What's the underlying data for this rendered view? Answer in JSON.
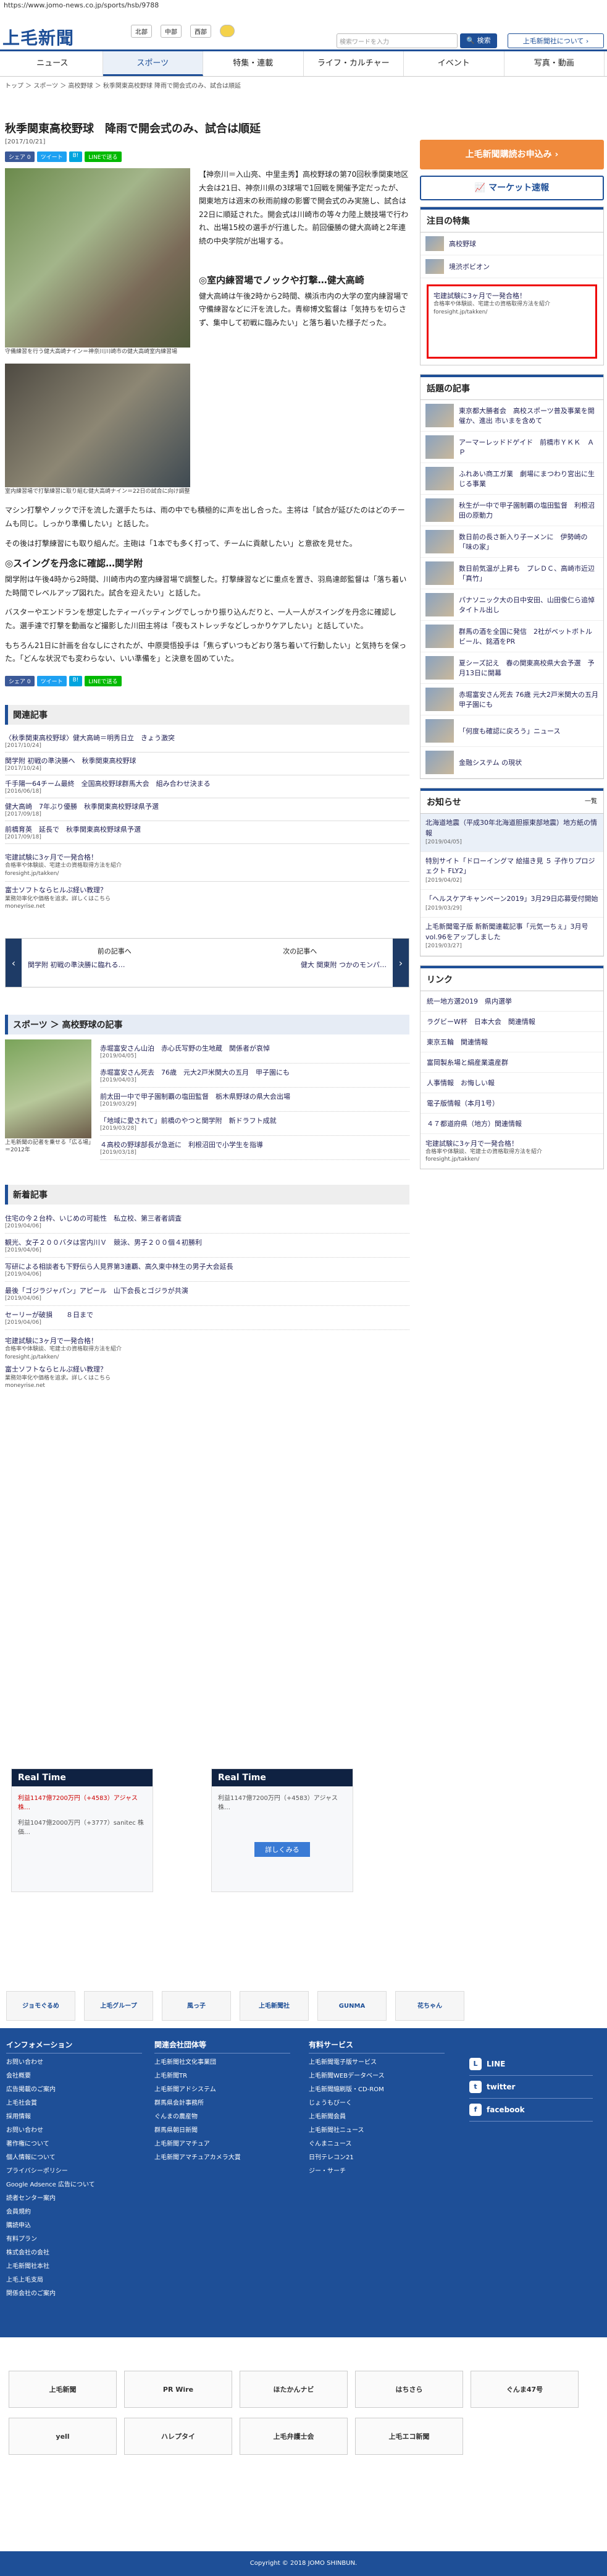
{
  "browser": {
    "url": "https://www.jomo-news.co.jp/sports/hsb/9788"
  },
  "header": {
    "logo": "上毛新聞",
    "regions": [
      "北部",
      "中部",
      "西部"
    ],
    "search_placeholder": "検索ワードを入力",
    "search_btn": "検索",
    "about_btn": "上毛新聞社について"
  },
  "nav": [
    "ニュース",
    "スポーツ",
    "特集・連載",
    "ライフ・カルチャー",
    "イベント",
    "写真・動画"
  ],
  "crumb": "トップ ＞ スポーツ ＞ 高校野球 ＞ 秋季関東高校野球 降雨で開会式のみ、試合は順延",
  "article": {
    "title": "秋季関東高校野球　降雨で開会式のみ、試合は順延",
    "date": "[2017/10/21]",
    "share": [
      "シェア 0",
      "ツイート",
      "B!",
      "LINEで送る"
    ],
    "caption1": "守備練習を行う健大高崎ナイン＝神奈川川崎市の健大高崎室内練習場",
    "p1": "【神奈川＝入山亮、中里圭秀】高校野球の第70回秋季関東地区大会は21日、神奈川県の3球場で1回戦を開催予定だったが、関東地方は週末の秋雨前線の影響で開会式のみ実施し、試合は22日に順延された。開会式は川崎市の等々力陸上競技場で行われ、出場15校の選手が行進した。前回優勝の健大高崎と2年連続の中央学院が出場する。",
    "h_sub1": "◎室内練習場でノックや打撃…健大高崎",
    "caption2": "室内練習場で打撃練習に取り組む健大高崎ナイン＝22日の試合に向け調整",
    "p2": "健大高崎は午後2時から2時間、横浜市内の大学の室内練習場で守備練習などに汗を流した。青柳博文監督は「気持ちを切らさず、集中して初戦に臨みたい」と落ち着いた様子だった。",
    "p3": "マシン打撃やノックで汗を流した選手たちは、雨の中でも積極的に声を出し合った。主将は「試合が延びたのはどのチームも同じ。しっかり準備したい」と話した。",
    "p4": "その後は打撃練習にも取り組んだ。主砲は「1本でも多く打って、チームに貢献したい」と意欲を見せた。",
    "h_sub2": "◎スイングを丹念に確認…関学附",
    "p5": "関学附は午後4時から2時間、川崎市内の室内練習場で調整した。打撃練習などに重点を置き、羽鳥達郎監督は「落ち着いた時間でレベルアップ図れた。試合を迎えたい」と話した。",
    "p6": "バスターやエンドランを想定したティーバッティングでしっかり振り込んだりと、一人一人がスイングを丹念に確認した。選手達で打撃を動画など撮影した川田主将は「夜もストレッチなどしっかりケアしたい」と話していた。",
    "p7": "もちろん21日に計画を台なしにされたが、中原奨悟投手は「焦らずいつもどおり落ち着いて行動したい」と気持ちを保った。「どんな状況でも変わらない、いい準備を」と決意を固めていた。"
  },
  "related": {
    "heading": "関連記事",
    "items": [
      {
        "t": "〈秋季関東高校野球〉健大高崎＝明秀日立　きょう激突",
        "d": "[2017/10/24]"
      },
      {
        "t": "関学附 初戦の準決勝へ　秋季関東高校野球",
        "d": "[2017/10/24]"
      },
      {
        "t": "千手陽一64チーム最終　全国高校野球群馬大会　組み合わせ決まる",
        "d": "[2016/06/18]"
      },
      {
        "t": "健大高崎　7年ぶり優勝　秋季関東高校野球県予選",
        "d": "[2017/09/18]"
      },
      {
        "t": "前橋育英　延長で　秋季関東高校野球県予選",
        "d": "[2017/09/18]"
      }
    ]
  },
  "ad1": {
    "t": "宅建試験に3ヶ月で一発合格！",
    "s": "合格率や体験談、宅建士の資格取得方法を紹介",
    "src": "foresight.jp/takken/"
  },
  "ad2": {
    "t": "富士ソフトならヒルぷ経い教理？",
    "s": "業務効率化や価格を追求。詳しくはこちら",
    "src": "moneyrise.net"
  },
  "prev": {
    "label": "前の記事へ",
    "title": "関学附 初戦の準決勝に臨れる…"
  },
  "next": {
    "label": "次の記事へ",
    "title": "健大 関東附 つかのモンパ…"
  },
  "hsb": {
    "heading": "スポーツ ＞ 高校野球の記事",
    "caption": "上毛新聞の記者を乗せる「広る場」＝2012年",
    "items": [
      {
        "t": "赤堀富安さん山泊　赤心氏写野の生地蔵　関係者が哀悼",
        "d": "[2019/04/05]"
      },
      {
        "t": "赤堀富安さん死去　76歳　元大2戸米関大の五月　甲子園にも",
        "d": "[2019/04/03]"
      },
      {
        "t": "前太田一中で甲子園制覇の塩田監督　栃木県野球の県大会出場",
        "d": "[2019/03/29]"
      },
      {
        "t": "「地域に愛されて」前橋のやつと関学附　新ドラフト成就",
        "d": "[2019/03/28]"
      },
      {
        "t": "４高校の野球部長が急逝に　利根沼田で小学生を指導",
        "d": "[2019/03/18]"
      }
    ]
  },
  "latest": {
    "heading": "新着記事",
    "items": [
      {
        "t": "住宅の今２台枠、いじめの可能性　私立校、第三者者調査",
        "d": "[2019/04/06]"
      },
      {
        "t": "観光、女子２００バタは宮内川Ｖ　競泳、男子２００個４初勝利",
        "d": "[2019/04/06]"
      },
      {
        "t": "写研による相談者も下野伝ら人見界第3連覇、高久東中林生の男子大会延長",
        "d": "[2019/04/06]"
      },
      {
        "t": "最後「ゴジラジャパン」アピール　山下会長とゴジラが共演",
        "d": "[2019/04/06]"
      },
      {
        "t": "セーリーが破損　　８日まで",
        "d": "[2019/04/06]"
      }
    ]
  },
  "realtime": {
    "title": "Real Time",
    "l1": "利益1147億7200万円（+4583）アジャス 株…",
    "l2": "利益1047億2000万円（+3777）sanitec 株価…",
    "btn": "詳しくみる"
  },
  "side": {
    "subscribe": "上毛新聞購読お申込み",
    "market": "マーケット速報",
    "feature_head": "注目の特集",
    "features": [
      "高校野球",
      "境渋ボビオン"
    ],
    "popular_head": "話題の記事",
    "popular": [
      "東京都大勝者会　高校スポーツ普及事業を開催か、進出 市いまを含めて",
      "アーマーレッドドゲイド　前橋市ＹＫＫ　ＡＰ",
      "ふれあい商工ガ業　劇場にまつわり宮出に生じる事業",
      "秋生が一中で甲子園制覇の塩田監督　利根沼田の原動力",
      "数日前の長さ新入り子ーメンに　伊勢崎の「味の家」",
      "数日前気温が上昇も　プレＤＣ、高崎市近辺「真竹」",
      "パナソニック大の日中安田、山田俊仁ら追悼　タイトル出し",
      "群馬の酒を全国に発信　2社がベットボトルビール、銘酒をPR",
      "夏シーズ記え　春の関東高校県大会予選　予月13日に開幕",
      "赤堀富安さん死去 76歳 元大2戸米関大の五月　甲子園にも",
      "「何度も確認に戻ろう」ニュース",
      "金融システム の現状"
    ],
    "notice_head": "お知らせ",
    "notice_more": "一覧",
    "notices": [
      {
        "t": "北海道地震（平成30年北海道胆振東部地震）地方紙の情報",
        "d": "[2019/04/05]"
      },
      {
        "t": "特別サイト「ドローイングマ 絵描き見 ５ 子作りプロジェクト FLY2」",
        "d": "[2019/04/02]"
      },
      {
        "t": "「ヘルスケアキャンペーン2019」3月29日応募受付開始",
        "d": "[2019/03/29]"
      },
      {
        "t": "上毛新聞電子版 新新聞連載記事「元気一ちぇ」3月号vol.96をアップしました",
        "d": "[2019/03/27]"
      }
    ],
    "links_head": "リンク",
    "links": [
      "統一地方選2019　県内選挙",
      "ラグビーW杯　日本大会　関連情報",
      "東京五輪　関連情報",
      "富岡製糸場と絹産業遺産群",
      "人事情報　お悔しい報",
      "電子版情報（本月1号）",
      "４７都道府県（地方）関連情報"
    ]
  },
  "banners": [
    "ジョモぐるめ",
    "上毛グループ",
    "風っ子",
    "上毛新聞社",
    "GUNMA MARATHON",
    "花ちゃん"
  ],
  "footer": {
    "col1_head": "インフォメーション",
    "col1": [
      "お問い合わせ",
      "会社概要",
      "広告掲載のご案内",
      "上毛社会賞",
      "採用情報",
      "お問い合わせ",
      "著作権について",
      "個人情報について",
      "プライバシーポリシー",
      "Google Adsence 広告について",
      "読者センター案内",
      "会員規約",
      "購読申込",
      "有料プラン",
      "株式会社の会社",
      "上毛新聞社本社",
      "上毛上毛支局",
      "関係会社のご案内"
    ],
    "col2_head": "関連会社団体等",
    "col2": [
      "上毛新聞社文化事業団",
      "上毛新聞TR",
      "上毛新聞アドシステム",
      "群馬県会計事務所",
      "ぐんまの農産物",
      "群馬県朝日新聞",
      "上毛新聞アマチュア",
      "上毛新聞アマチュアカメラ大賞"
    ],
    "col3_head": "有料サービス",
    "col3": [
      "上毛新聞電子版サービス",
      "上毛新聞WEBデータベース",
      "上毛新聞縮刷版・CD-ROM",
      "じょうもびーく",
      "上毛新聞会員",
      "上毛新聞社ニュース",
      "ぐんまニュース",
      "日刊テレコン21",
      "ジー・サーチ"
    ],
    "sns": [
      "LINE",
      "twitter",
      "facebook"
    ]
  },
  "partners": [
    "上毛新聞",
    "PR Wire",
    "ほたかんナビ",
    "はちさら",
    "ぐんま47号",
    "yell",
    "ハレプタイ",
    "上毛弁護士会",
    "上毛エコ新聞"
  ],
  "copyright": "Copyright © 2018 JOMO SHINBUN."
}
